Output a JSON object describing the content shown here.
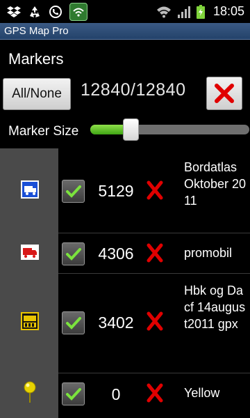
{
  "status_bar": {
    "time": "18:05",
    "left_icons": [
      "dropbox-icon",
      "recycle-icon",
      "phone-icon",
      "app-icon"
    ],
    "right_icons": [
      "wifi-icon",
      "signal-icon",
      "battery-charging-icon"
    ]
  },
  "title_bar": {
    "title": "GPS Map Pro"
  },
  "markers": {
    "title": "Markers",
    "all_none_label": "All/None",
    "count": "12840/12840",
    "size_label": "Marker Size",
    "size_level": 0.24
  },
  "items": [
    {
      "icon": "truck-sign-icon",
      "checked": true,
      "count": "5129",
      "name": "Bordatlas Oktober 2011"
    },
    {
      "icon": "red-truck-icon",
      "checked": true,
      "count": "4306",
      "name": "promobil"
    },
    {
      "icon": "hbk-sign-icon",
      "checked": true,
      "count": "3402",
      "name": "Hbk og Dacf 14august2011 gpx"
    },
    {
      "icon": "yellow-pin-icon",
      "checked": true,
      "count": "0",
      "name": "Yellow"
    }
  ],
  "colors": {
    "accent_green": "#4caf1a",
    "delete_red": "#e00000",
    "title_bar": "#2c4b74"
  }
}
